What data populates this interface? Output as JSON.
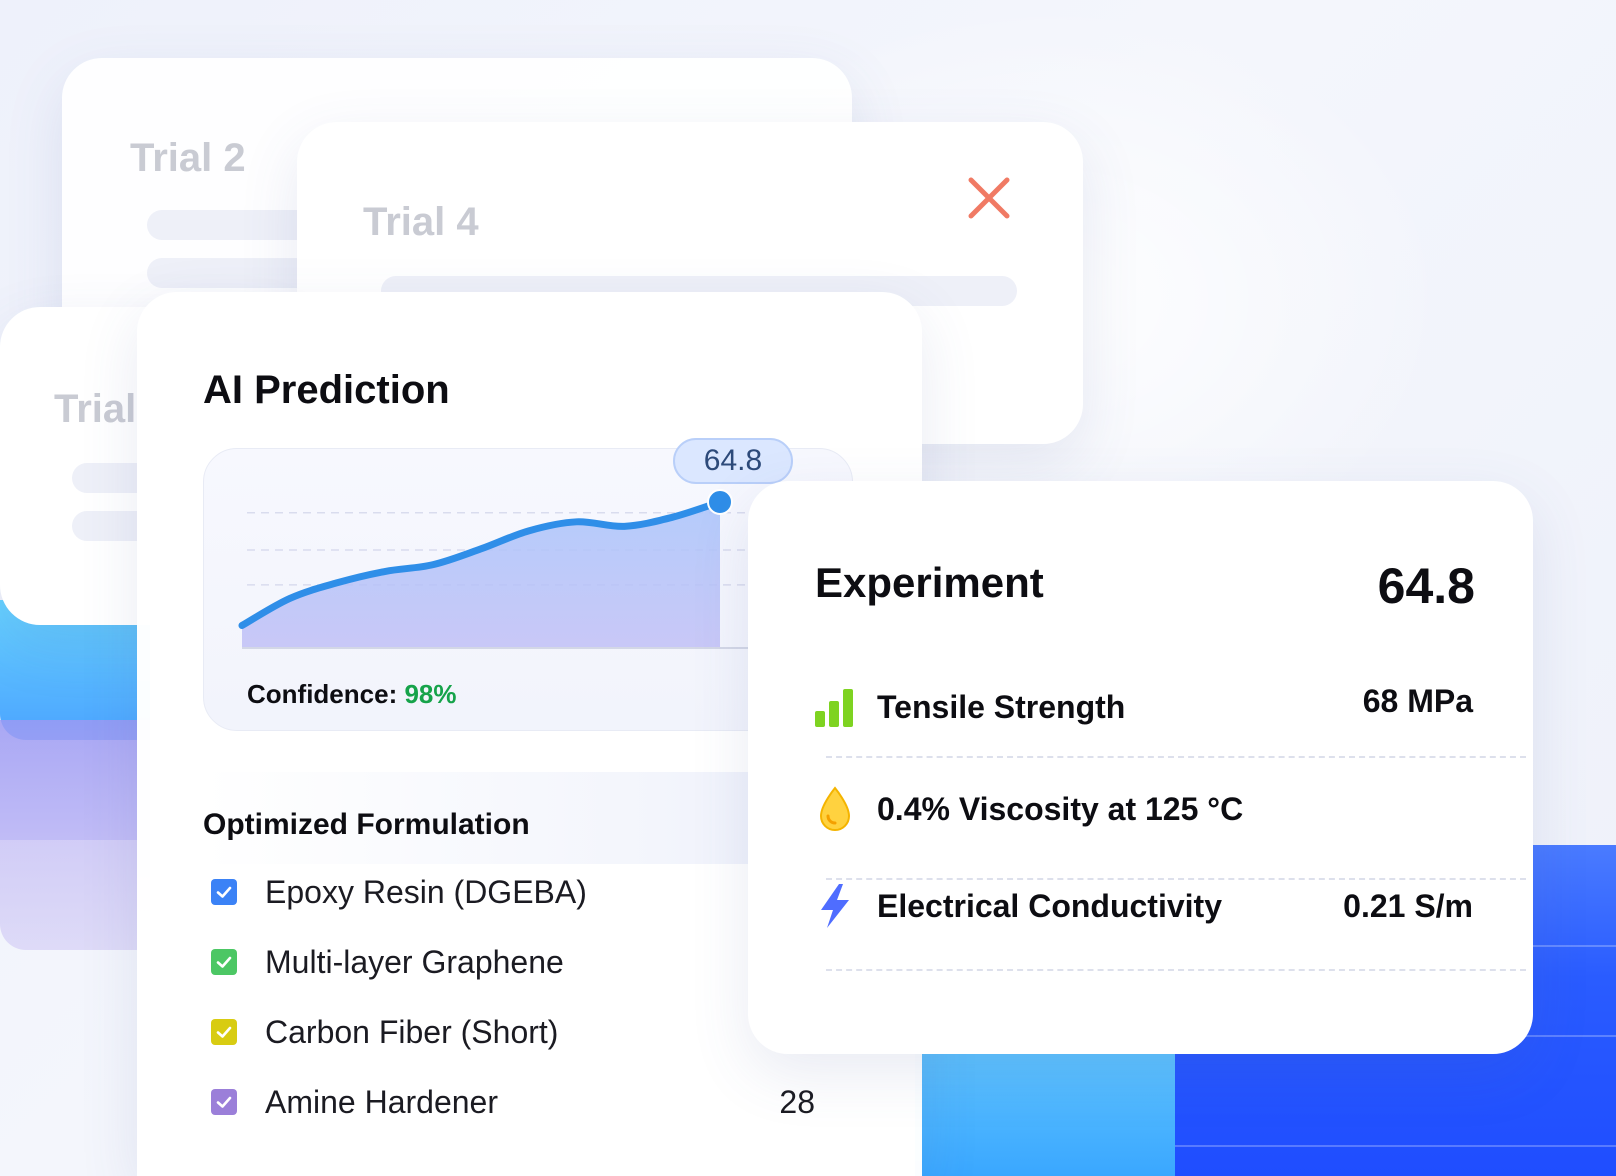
{
  "trials": {
    "trial2_title": "Trial 2",
    "trial4_title": "Trial 4",
    "trial1_title": "Trial"
  },
  "prediction": {
    "title": "AI Prediction",
    "peak_value": "64.8",
    "confidence_label": "Confidence:",
    "confidence_value": "98%"
  },
  "chart_data": {
    "type": "area",
    "title": "",
    "xlabel": "",
    "ylabel": "",
    "x": [
      0,
      1,
      2,
      3,
      4,
      5,
      6,
      7,
      8,
      9,
      10
    ],
    "y": [
      10,
      22,
      29,
      34,
      37,
      44,
      52,
      56,
      54,
      58,
      64.8
    ],
    "ylim": [
      0,
      75
    ],
    "grid": "dashed horizontal",
    "peak_label": "64.8",
    "line_color": "#2f8ee8",
    "fill_top": "#a9c4fb",
    "fill_bottom": "#c1c0f6"
  },
  "formulation": {
    "title": "Optimized Formulation",
    "items": [
      {
        "name": "Epoxy Resin (DGEBA)",
        "qty": "",
        "color": "#3b82f6"
      },
      {
        "name": "Multi-layer Graphene",
        "qty": "",
        "color": "#4cc764"
      },
      {
        "name": "Carbon Fiber (Short)",
        "qty": "",
        "color": "#d8cc12"
      },
      {
        "name": "Amine Hardener",
        "qty": "28",
        "color": "#9b7fd9"
      }
    ]
  },
  "experiment": {
    "title": "Experiment",
    "score": "64.8",
    "metrics": [
      {
        "icon": "bar-chart-icon",
        "label": "Tensile Strength",
        "value": "68 MPa"
      },
      {
        "icon": "droplet-icon",
        "label": "0.4% Viscosity at 125 °C",
        "value": ""
      },
      {
        "icon": "lightning-icon",
        "label": "Electrical Conductivity",
        "value": "0.21 S/m"
      }
    ]
  },
  "colors": {
    "close": "#f07a64",
    "confidence": "#16a34a",
    "accent_blue": "#2a5cff"
  }
}
